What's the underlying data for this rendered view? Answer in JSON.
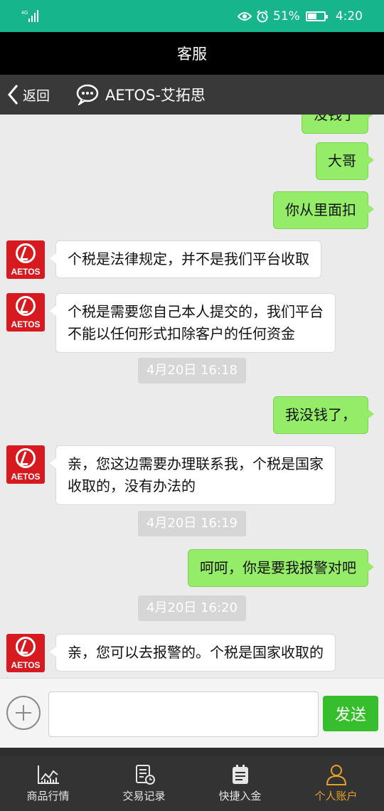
{
  "status_bar": {
    "network": "4G",
    "battery": "51%",
    "battery_level": 0.51,
    "time": "4:20",
    "icons": [
      "signal-icon",
      "eye-icon",
      "alarm-icon",
      "battery-icon"
    ]
  },
  "title_bar": {
    "title": "客服"
  },
  "chat_header": {
    "back_label": "返回",
    "contact_name": "AETOS-艾拓思",
    "icons": [
      "chevron-left-icon",
      "chat-bubble-icon"
    ]
  },
  "messages": [
    {
      "type": "out",
      "text": "没钱了"
    },
    {
      "type": "out",
      "text": "大哥"
    },
    {
      "type": "out",
      "text": "你从里面扣"
    },
    {
      "type": "in",
      "text": "个税是法律规定，并不是我们平台收取"
    },
    {
      "type": "in",
      "lines": [
        "个税是需要您自己本人提交的，我们平台",
        "不能以任何形式扣除客户的任何资金"
      ]
    },
    {
      "type": "time",
      "text": "4月20日 16:18"
    },
    {
      "type": "out",
      "text": "我没钱了，"
    },
    {
      "type": "in",
      "lines": [
        "亲，您这边需要办理联系我，个税是国家",
        "收取的，没有办法的"
      ]
    },
    {
      "type": "time",
      "text": "4月20日 16:19"
    },
    {
      "type": "out",
      "text": "呵呵，你是要我报警对吧"
    },
    {
      "type": "time",
      "text": "4月20日 16:20"
    },
    {
      "type": "in",
      "text": "亲，您可以去报警的。个税是国家收取的"
    }
  ],
  "avatar": {
    "brand": "AETOS",
    "color": "#d71920"
  },
  "input_bar": {
    "value": "",
    "placeholder": "",
    "send_label": "发送"
  },
  "bottom_nav": [
    {
      "label": "商品行情",
      "icon": "market-chart-icon",
      "active": false
    },
    {
      "label": "交易记录",
      "icon": "records-icon",
      "active": false
    },
    {
      "label": "快捷入金",
      "icon": "deposit-icon",
      "active": false
    },
    {
      "label": "个人账户",
      "icon": "user-icon",
      "active": true
    }
  ],
  "colors": {
    "status_bar": "#16b58b",
    "header": "#393939",
    "outgoing_bubble": "#95ec69",
    "send_button": "#37be2d",
    "nav_active": "#e6a12a"
  }
}
